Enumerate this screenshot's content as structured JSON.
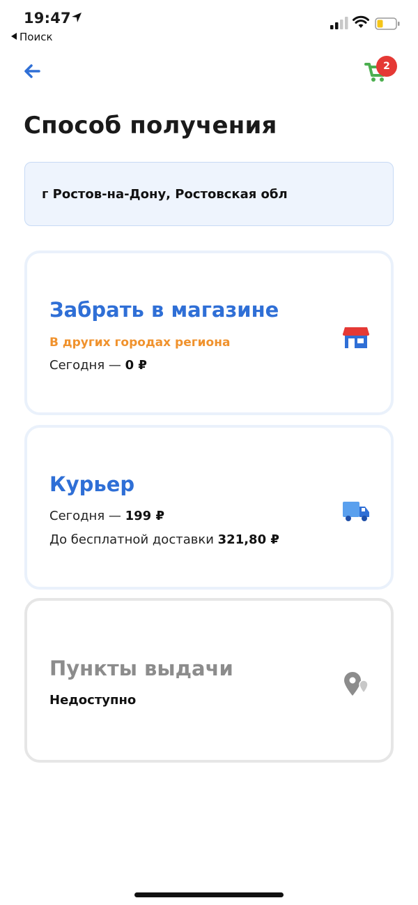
{
  "status_bar": {
    "time": "19:47",
    "back_app_label": "Поиск"
  },
  "header": {
    "cart_count": "2",
    "accent_color": "#2f6fd6",
    "cart_color": "#4caf50"
  },
  "page": {
    "title": "Способ получения"
  },
  "address": {
    "text": "г Ростов-на-Дону, Ростовская обл"
  },
  "options": [
    {
      "title": "Забрать в магазине",
      "subtitle": "В других городах региона",
      "line1_prefix": "Сегодня — ",
      "line1_value": "0 ₽",
      "icon": "store-icon"
    },
    {
      "title": "Курьер",
      "line1_prefix": "Сегодня — ",
      "line1_value": "199 ₽",
      "line2_prefix": "До бесплатной доставки ",
      "line2_value": "321,80 ₽",
      "icon": "truck-icon"
    },
    {
      "title": "Пункты выдачи",
      "status": "Недоступно",
      "icon": "location-pin-icon"
    }
  ]
}
